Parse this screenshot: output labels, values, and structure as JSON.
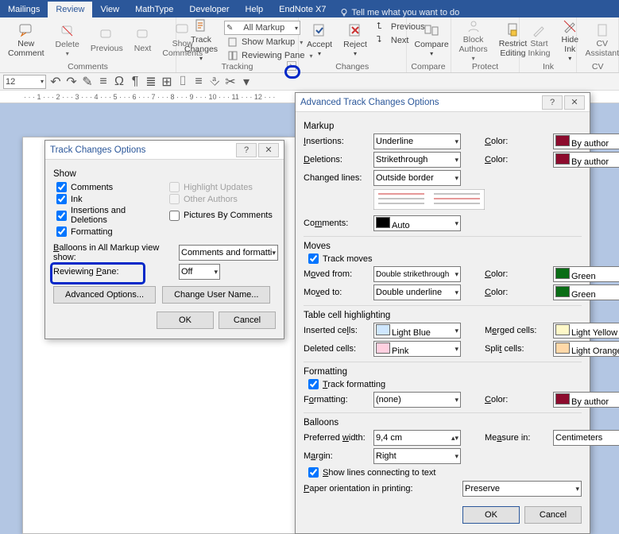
{
  "ribbon": {
    "tabs": [
      "Mailings",
      "Review",
      "View",
      "MathType",
      "Developer",
      "Help",
      "EndNote X7"
    ],
    "active_tab": "Review",
    "tellme_placeholder": "Tell me what you want to do",
    "groups": {
      "comments": {
        "label": "Comments",
        "new_comment": "New\nComment",
        "delete": "Delete",
        "previous": "Previous",
        "next": "Next",
        "show_comments": "Show\nComments"
      },
      "tracking": {
        "label": "Tracking",
        "track_changes": "Track\nChanges",
        "all_markup": "All Markup",
        "show_markup": "Show Markup",
        "reviewing_pane": "Reviewing Pane"
      },
      "changes": {
        "label": "Changes",
        "accept": "Accept",
        "reject": "Reject",
        "previous": "Previous",
        "next": "Next"
      },
      "compare": {
        "label": "Compare",
        "compare": "Compare"
      },
      "protect": {
        "label": "Protect",
        "block_authors": "Block\nAuthors",
        "restrict_editing": "Restrict\nEditing"
      },
      "ink": {
        "label": "Ink",
        "start_inking": "Start\nInking",
        "hide_ink": "Hide\nInk"
      },
      "cv": {
        "label": "CV",
        "cv_assistant": "CV\nAssistant"
      }
    }
  },
  "qat": {
    "font_size": "12"
  },
  "dialog1": {
    "title": "Track Changes Options",
    "section_show": "Show",
    "comments": "Comments",
    "ink": "Ink",
    "ins_del": "Insertions and Deletions",
    "formatting": "Formatting",
    "highlight": "Highlight Updates",
    "other_authors": "Other Authors",
    "pictures": "Pictures By Comments",
    "balloons_label": "Balloons in All Markup view show:",
    "balloons_value": "Comments and formatting",
    "pane_label": "Reviewing Pane:",
    "pane_value": "Off",
    "advanced": "Advanced Options...",
    "change_user": "Change User Name...",
    "ok": "OK",
    "cancel": "Cancel"
  },
  "dialog2": {
    "title": "Advanced Track Changes Options",
    "sections": {
      "markup": "Markup",
      "moves": "Moves",
      "tch": "Table cell highlighting",
      "formatting": "Formatting",
      "balloons": "Balloons"
    },
    "labels": {
      "insertions": "Insertions:",
      "deletions": "Deletions:",
      "changed_lines": "Changed lines:",
      "comments": "Comments:",
      "track_moves": "Track moves",
      "moved_from": "Moved from:",
      "moved_to": "Moved to:",
      "inserted_cells": "Inserted cells:",
      "deleted_cells": "Deleted cells:",
      "track_formatting": "Track formatting",
      "formatting": "Formatting:",
      "preferred_width": "Preferred width:",
      "margin": "Margin:",
      "show_lines": "Show lines connecting to text",
      "paper_orientation": "Paper orientation in printing:",
      "color": "Color:",
      "merged_cells": "Merged cells:",
      "split_cells": "Split cells:",
      "measure_in": "Measure in:"
    },
    "values": {
      "insertions": "Underline",
      "deletions": "Strikethrough",
      "changed_lines": "Outside border",
      "comments": "Auto",
      "moved_from": "Double strikethrough",
      "moved_to": "Double underline",
      "inserted_cells": "Light Blue",
      "deleted_cells": "Pink",
      "merged_cells": "Light Yellow",
      "split_cells": "Light Orange",
      "formatting": "(none)",
      "preferred_width": "9,4 cm",
      "margin": "Right",
      "paper_orientation": "Preserve",
      "measure_in": "Centimeters",
      "color_byauthor": "By author",
      "color_green": "Green"
    },
    "colors": {
      "byauthor": "#8c0b2d",
      "green": "#0a6d16",
      "lightblue": "#cfe7ff",
      "pink": "#ffd0e0",
      "lightyellow": "#fff8c8",
      "lightorange": "#ffd8a8",
      "auto": "#000000"
    },
    "ok": "OK",
    "cancel": "Cancel"
  }
}
